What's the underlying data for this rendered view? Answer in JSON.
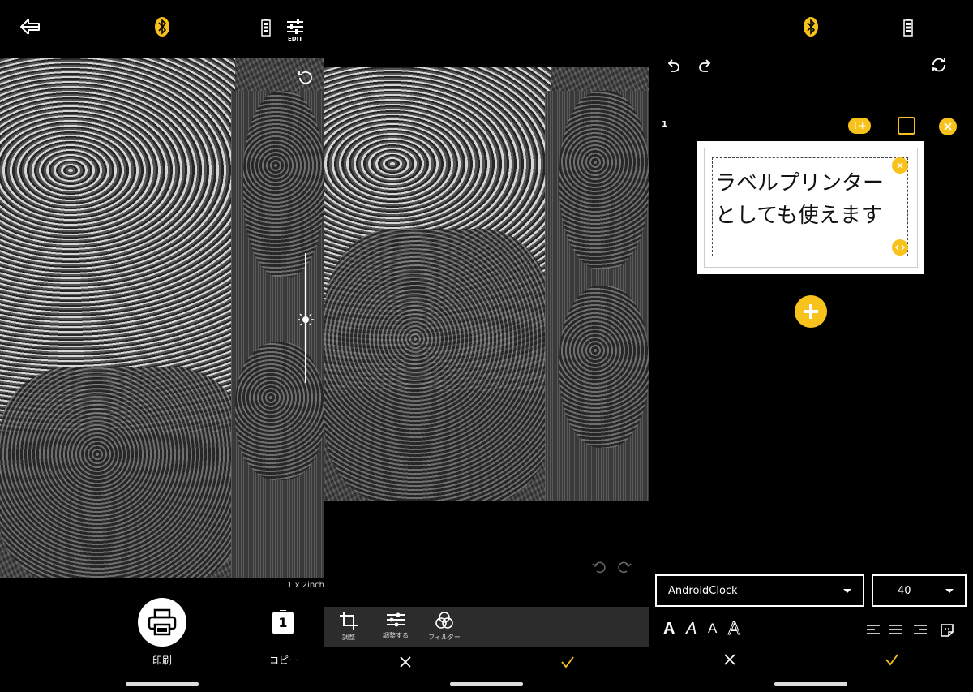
{
  "panel1": {
    "header": {
      "back_icon": "back-arrow-icon",
      "bluetooth_icon": "bluetooth-icon",
      "battery_icon": "battery-icon",
      "edit_label": "EDIT"
    },
    "size_label": "1 x 2inch",
    "actions": [
      {
        "label": "印刷",
        "icon": "printer-icon"
      },
      {
        "label": "コピー",
        "icon": "copy-count-icon",
        "count": "1"
      }
    ]
  },
  "panel2": {
    "tools": [
      {
        "label": "調整",
        "icon": "crop-icon"
      },
      {
        "label": "調整する",
        "icon": "sliders-icon"
      },
      {
        "label": "フィルター",
        "icon": "filter-icon"
      }
    ]
  },
  "panel3": {
    "label_number": "1",
    "label_text": "ラベルプリンター\nとしても使えます",
    "text_add_badge": "T+",
    "font_dropdown": "AndroidClock",
    "size_dropdown": "40"
  },
  "colors": {
    "accent": "#f7c21b",
    "background": "#000000",
    "toolbar": "#2c2c2c"
  }
}
